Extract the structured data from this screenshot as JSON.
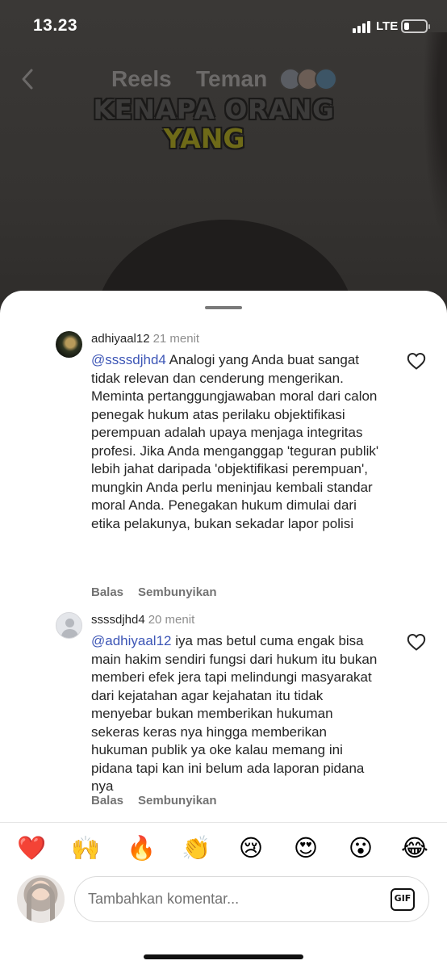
{
  "status_bar": {
    "time": "13.23",
    "network": "LTE"
  },
  "reel": {
    "tabs": [
      "Reels",
      "Teman"
    ],
    "caption_line1": "KENAPA ORANG",
    "caption_line2": "YANG"
  },
  "comments": [
    {
      "username": "adhiyaal12",
      "time": "21 menit",
      "mention": "@ssssdjhd4",
      "text": " Analogi yang Anda buat sangat tidak relevan dan cenderung mengerikan. Meminta pertanggungjawaban moral dari calon penegak hukum atas perilaku objektifikasi perempuan adalah upaya menjaga integritas profesi. Jika Anda menganggap 'teguran publik' lebih jahat daripada 'objektifikasi perempuan', mungkin Anda perlu meninjau kembali standar moral Anda. Penegakan hukum dimulai dari etika pelakunya, bukan sekadar lapor polisi",
      "reply_label": "Balas",
      "hide_label": "Sembunyikan"
    },
    {
      "username": "ssssdjhd4",
      "time": "20 menit",
      "mention": "@adhiyaal12",
      "text": " iya mas betul cuma engak bisa main hakim sendiri fungsi dari hukum itu bukan memberi efek jera tapi melindungi masyarakat dari kejatahan agar kejahatan itu tidak menyebar bukan memberikan hukuman sekeras keras nya hingga memberikan hukuman publik ya oke kalau memang ini pidana tapi kan ini belum ada laporan pidana nya",
      "reply_label": "Balas",
      "hide_label": "Sembunyikan"
    }
  ],
  "emoji_bar": [
    "❤️",
    "🙌",
    "🔥",
    "👏",
    "😢",
    "😍",
    "😮",
    "😂"
  ],
  "composer": {
    "placeholder": "Tambahkan komentar...",
    "gif_label": "GIF"
  },
  "colors": {
    "mention": "#3d56b6",
    "meta_gray": "#8e8e8e",
    "text": "#262626"
  }
}
